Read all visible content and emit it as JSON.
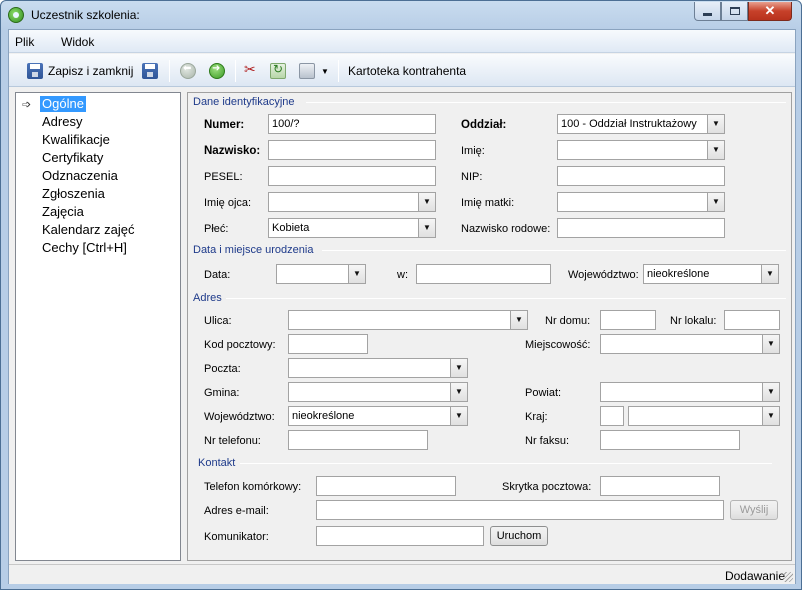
{
  "window": {
    "title": "Uczestnik szkolenia:"
  },
  "menu": {
    "file": "Plik",
    "view": "Widok"
  },
  "toolbar": {
    "save_close": "Zapisz i zamknij",
    "contractor": "Kartoteka kontrahenta"
  },
  "tree": {
    "items": [
      "Ogólne",
      "Adresy",
      "Kwalifikacje",
      "Certyfikaty",
      "Odznaczenia",
      "Zgłoszenia",
      "Zajęcia",
      "Kalendarz zajęć",
      "Cechy [Ctrl+H]"
    ]
  },
  "identity": {
    "section": "Dane identyfikacyjne",
    "number_label": "Numer:",
    "number_value": "100/?",
    "branch_label": "Oddział:",
    "branch_value": "100 - Oddział Instruktażowy",
    "surname_label": "Nazwisko:",
    "first_name_label": "Imię:",
    "pesel_label": "PESEL:",
    "nip_label": "NIP:",
    "father_label": "Imię ojca:",
    "mother_label": "Imię matki:",
    "gender_label": "Płeć:",
    "gender_value": "Kobieta",
    "maiden_label": "Nazwisko rodowe:"
  },
  "birth": {
    "section": "Data i miejsce urodzenia",
    "date_label": "Data:",
    "place_label": "w:",
    "province_label": "Województwo:",
    "province_value": "nieokreślone"
  },
  "address": {
    "section": "Adres",
    "street_label": "Ulica:",
    "house_label": "Nr domu:",
    "flat_label": "Nr lokalu:",
    "postal_label": "Kod pocztowy:",
    "city_label": "Miejscowość:",
    "post_label": "Poczta:",
    "commune_label": "Gmina:",
    "county_label": "Powiat:",
    "province_label": "Województwo:",
    "province_value": "nieokreślone",
    "country_label": "Kraj:",
    "phone_label": "Nr telefonu:",
    "fax_label": "Nr faksu:"
  },
  "contact": {
    "section": "Kontakt",
    "mobile_label": "Telefon komórkowy:",
    "pobox_label": "Skrytka pocztowa:",
    "email_label": "Adres e-mail:",
    "send_button": "Wyślij",
    "messenger_label": "Komunikator:",
    "launch_button": "Uruchom"
  },
  "status": {
    "mode": "Dodawanie"
  }
}
